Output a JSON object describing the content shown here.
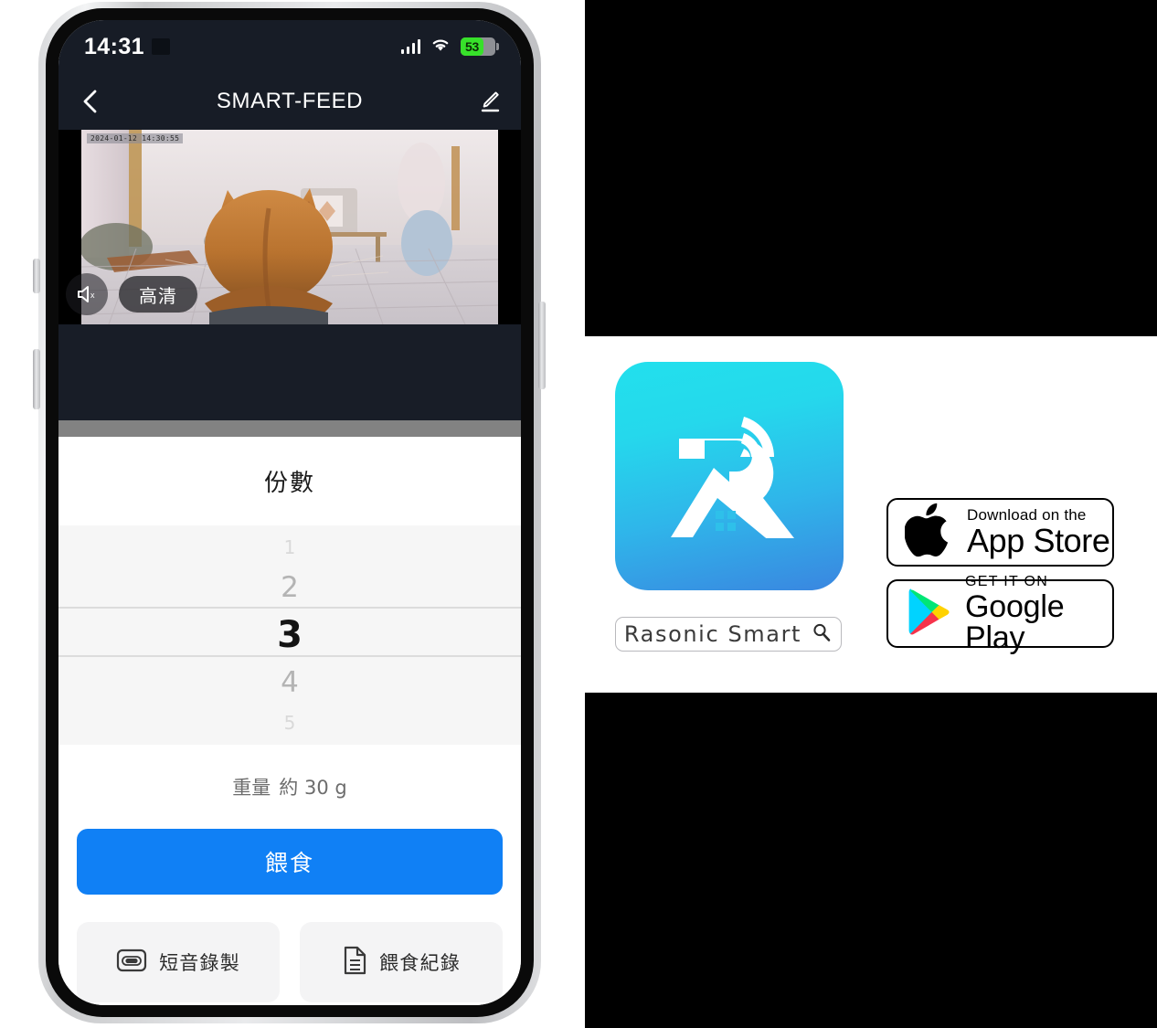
{
  "phone": {
    "status_bar": {
      "time": "14:31",
      "signal_icon": "cellular-signal-icon",
      "wifi_icon": "wifi-icon",
      "battery_percent": "53",
      "battery_color": "#37e12a"
    },
    "nav": {
      "back_icon": "chevron-left-icon",
      "title": "SMART-FEED",
      "edit_icon": "pencil-edit-icon"
    },
    "video": {
      "timestamp": "2024-01-12 14:30:55",
      "mute_icon": "speaker-muted-icon",
      "quality_label": "高清"
    },
    "sheet": {
      "title": "份數",
      "picker": {
        "options": [
          "1",
          "2",
          "3",
          "4",
          "5"
        ],
        "selected": "3",
        "selected_index": 2
      },
      "weight_label": "重量",
      "weight_value": "約 30 g",
      "feed_button": "餵食",
      "actions": [
        {
          "icon": "cassette-tape-icon",
          "label": "短音錄製"
        },
        {
          "icon": "document-list-icon",
          "label": "餵食紀錄"
        }
      ]
    }
  },
  "store_panel": {
    "app_icon": {
      "name": "rasonic-smart-app-icon",
      "gradient_from": "#22e0ed",
      "gradient_to": "#3a86e0"
    },
    "app_name": "Rasonic Smart",
    "search_icon": "magnifier-icon",
    "badges": [
      {
        "icon": "apple-logo-icon",
        "small_text": "Download on the",
        "big_text": "App Store"
      },
      {
        "icon": "google-play-logo-icon",
        "small_text": "GET IT ON",
        "big_text": "Google Play"
      }
    ]
  }
}
